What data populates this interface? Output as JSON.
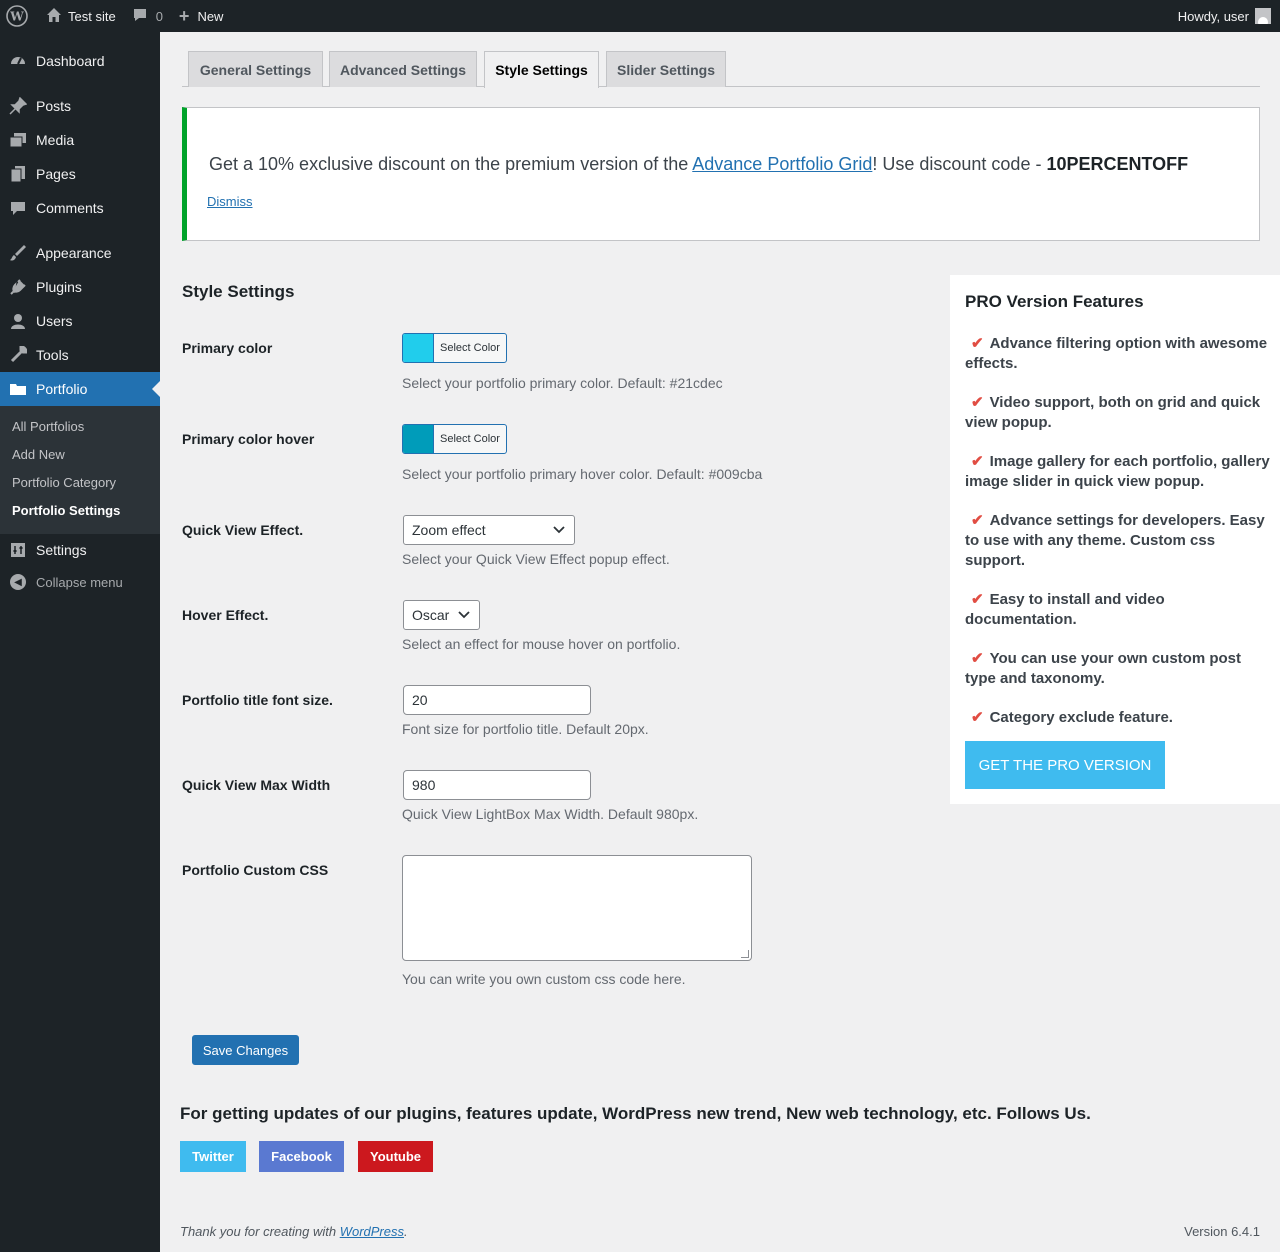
{
  "adminbar": {
    "site_name": "Test site",
    "comments_count": "0",
    "new_label": "New",
    "greeting": "Howdy, user"
  },
  "sidebar": {
    "items": [
      {
        "label": "Dashboard",
        "icon": "dashboard-icon"
      },
      {
        "label": "Posts",
        "icon": "pin-icon"
      },
      {
        "label": "Media",
        "icon": "media-icon"
      },
      {
        "label": "Pages",
        "icon": "pages-icon"
      },
      {
        "label": "Comments",
        "icon": "comments-icon"
      },
      {
        "label": "Appearance",
        "icon": "brush-icon"
      },
      {
        "label": "Plugins",
        "icon": "plug-icon"
      },
      {
        "label": "Users",
        "icon": "user-icon"
      },
      {
        "label": "Tools",
        "icon": "wrench-icon"
      },
      {
        "label": "Portfolio",
        "icon": "folder-icon"
      },
      {
        "label": "Settings",
        "icon": "settings-icon"
      }
    ],
    "submenu": [
      "All Portfolios",
      "Add New",
      "Portfolio Category",
      "Portfolio Settings"
    ],
    "collapse_label": "Collapse menu"
  },
  "tabs": [
    "General Settings",
    "Advanced Settings",
    "Style Settings",
    "Slider Settings"
  ],
  "notice": {
    "text_before": "Get a 10% exclusive discount on the premium version of the ",
    "link_text": "Advance Portfolio Grid",
    "text_after": "! Use discount code - ",
    "code": "10PERCENTOFF",
    "dismiss": "Dismiss"
  },
  "form": {
    "section_title": "Style Settings",
    "primary_color": {
      "label": "Primary color",
      "button": "Select Color",
      "swatch": "#21cdec",
      "desc": "Select your portfolio primary color. Default: #21cdec"
    },
    "primary_hover": {
      "label": "Primary color hover",
      "button": "Select Color",
      "swatch": "#009cba",
      "desc": "Select your portfolio primary hover color. Default: #009cba"
    },
    "quick_view": {
      "label": "Quick View Effect.",
      "value": "Zoom effect",
      "desc": "Select your Quick View Effect popup effect."
    },
    "hover_effect": {
      "label": "Hover Effect.",
      "value": "Oscar",
      "desc": "Select an effect for mouse hover on portfolio."
    },
    "title_font_size": {
      "label": "Portfolio title font size.",
      "value": "20",
      "desc": "Font size for portfolio title. Default 20px."
    },
    "max_width": {
      "label": "Quick View Max Width",
      "value": "980",
      "desc": "Quick View LightBox Max Width. Default 980px."
    },
    "custom_css": {
      "label": "Portfolio Custom CSS",
      "desc": "You can write you own custom css code here."
    },
    "save": "Save Changes"
  },
  "pro": {
    "title": "PRO Version Features",
    "features": [
      "Advance filtering option with awesome effects.",
      "Video support, both on grid and quick view popup.",
      "Image gallery for each portfolio, gallery image slider in quick view popup.",
      "Advance settings for developers. Easy to use with any theme. Custom css support.",
      "Easy to install and video documentation.",
      "You can use your own custom post type and taxonomy.",
      "Category exclude feature."
    ],
    "button": "GET THE PRO VERSION"
  },
  "follow": {
    "text": "For getting updates of our plugins, features update, WordPress new trend, New web technology, etc. Follows Us.",
    "links": [
      {
        "label": "Twitter",
        "color": "#3fbbef"
      },
      {
        "label": "Facebook",
        "color": "#5a79d1"
      },
      {
        "label": "Youtube",
        "color": "#cc181e"
      }
    ]
  },
  "footer": {
    "thanks_before": "Thank you for creating with ",
    "thanks_link": "WordPress",
    "thanks_after": ".",
    "version": "Version 6.4.1"
  }
}
